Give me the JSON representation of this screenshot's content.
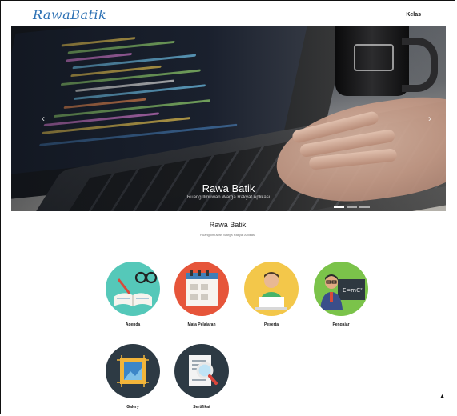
{
  "header": {
    "logo_text": "RawaBatik",
    "nav_kelas": "Kelas"
  },
  "hero": {
    "caption_title": "Rawa Batik",
    "caption_subtitle": "Ruang Ilmuwan Warga Rakyat Aplikasi",
    "prev_icon": "chevron-left",
    "next_icon": "chevron-right",
    "slides_total": 3,
    "slide_active": 1
  },
  "intro": {
    "title": "Rawa Batik",
    "subtitle": "Ruang Ilmuwan Warga Rakyat Aplikasi"
  },
  "menu": [
    {
      "label": "Agenda",
      "icon": "open-book-icon",
      "color": "#55c8b9"
    },
    {
      "label": "Mata Pelajaran",
      "icon": "calendar-icon",
      "color": "#e6553a"
    },
    {
      "label": "Peserta",
      "icon": "student-laptop-icon",
      "color": "#f3c74a"
    },
    {
      "label": "Pengajar",
      "icon": "teacher-blackboard-icon",
      "color": "#7bc34a"
    },
    {
      "label": "Galery",
      "icon": "picture-frame-icon",
      "color": "#2d3a44"
    },
    {
      "label": "Sertifikat",
      "icon": "document-search-icon",
      "color": "#2d3a44"
    }
  ],
  "scroll_top_icon": "caret-up-icon"
}
